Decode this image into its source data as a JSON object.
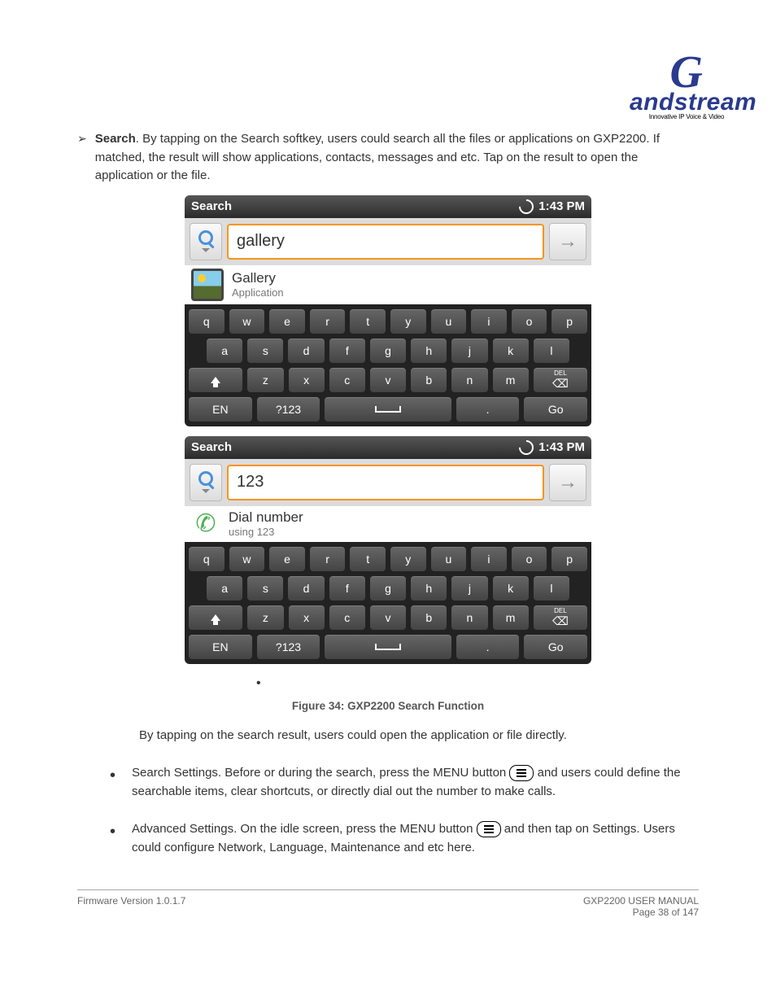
{
  "logo": {
    "main": "andstream",
    "initial": "G",
    "tag": "Innovative IP Voice & Video"
  },
  "intro": {
    "title": "Search",
    "body": "By tapping on the Search softkey, users could search all the files or applications on GXP2200. If matched, the result will show applications, contacts, messages and etc. Tap on the result to open the application or the file."
  },
  "ss1": {
    "title": "Search",
    "time": "1:43 PM",
    "input": "gallery",
    "result_title": "Gallery",
    "result_sub": "Application"
  },
  "ss2": {
    "title": "Search",
    "time": "1:43 PM",
    "input": "123",
    "result_title": "Dial number",
    "result_sub": "using 123"
  },
  "keys": {
    "r1": [
      "q",
      "w",
      "e",
      "r",
      "t",
      "y",
      "u",
      "i",
      "o",
      "p"
    ],
    "r2": [
      "a",
      "s",
      "d",
      "f",
      "g",
      "h",
      "j",
      "k",
      "l"
    ],
    "r3": [
      "z",
      "x",
      "c",
      "v",
      "b",
      "n",
      "m"
    ],
    "del_label": "DEL",
    "en": "EN",
    "num": "?123",
    "dot": ".",
    "go": "Go"
  },
  "caption": "Figure 34: GXP2200 Search Function",
  "trailing_line": "By tapping on the search result, users could open the application or file directly.",
  "bullets": {
    "b1_a": "Search Settings. Before or during the search, press the MENU button",
    "b1_b": "and users could define the searchable items, clear shortcuts, or directly dial out the number to make calls.",
    "b2_a": "Advanced Settings. On the idle screen, press the MENU button",
    "b2_b": "and then tap on Settings. Users could configure Network, Language, Maintenance and etc here."
  },
  "footer": {
    "left_top": "Firmware Version 1.0.1.7",
    "left_bot": "",
    "right_top": "GXP2200 USER MANUAL",
    "right_bot": "Page 38 of 147"
  }
}
